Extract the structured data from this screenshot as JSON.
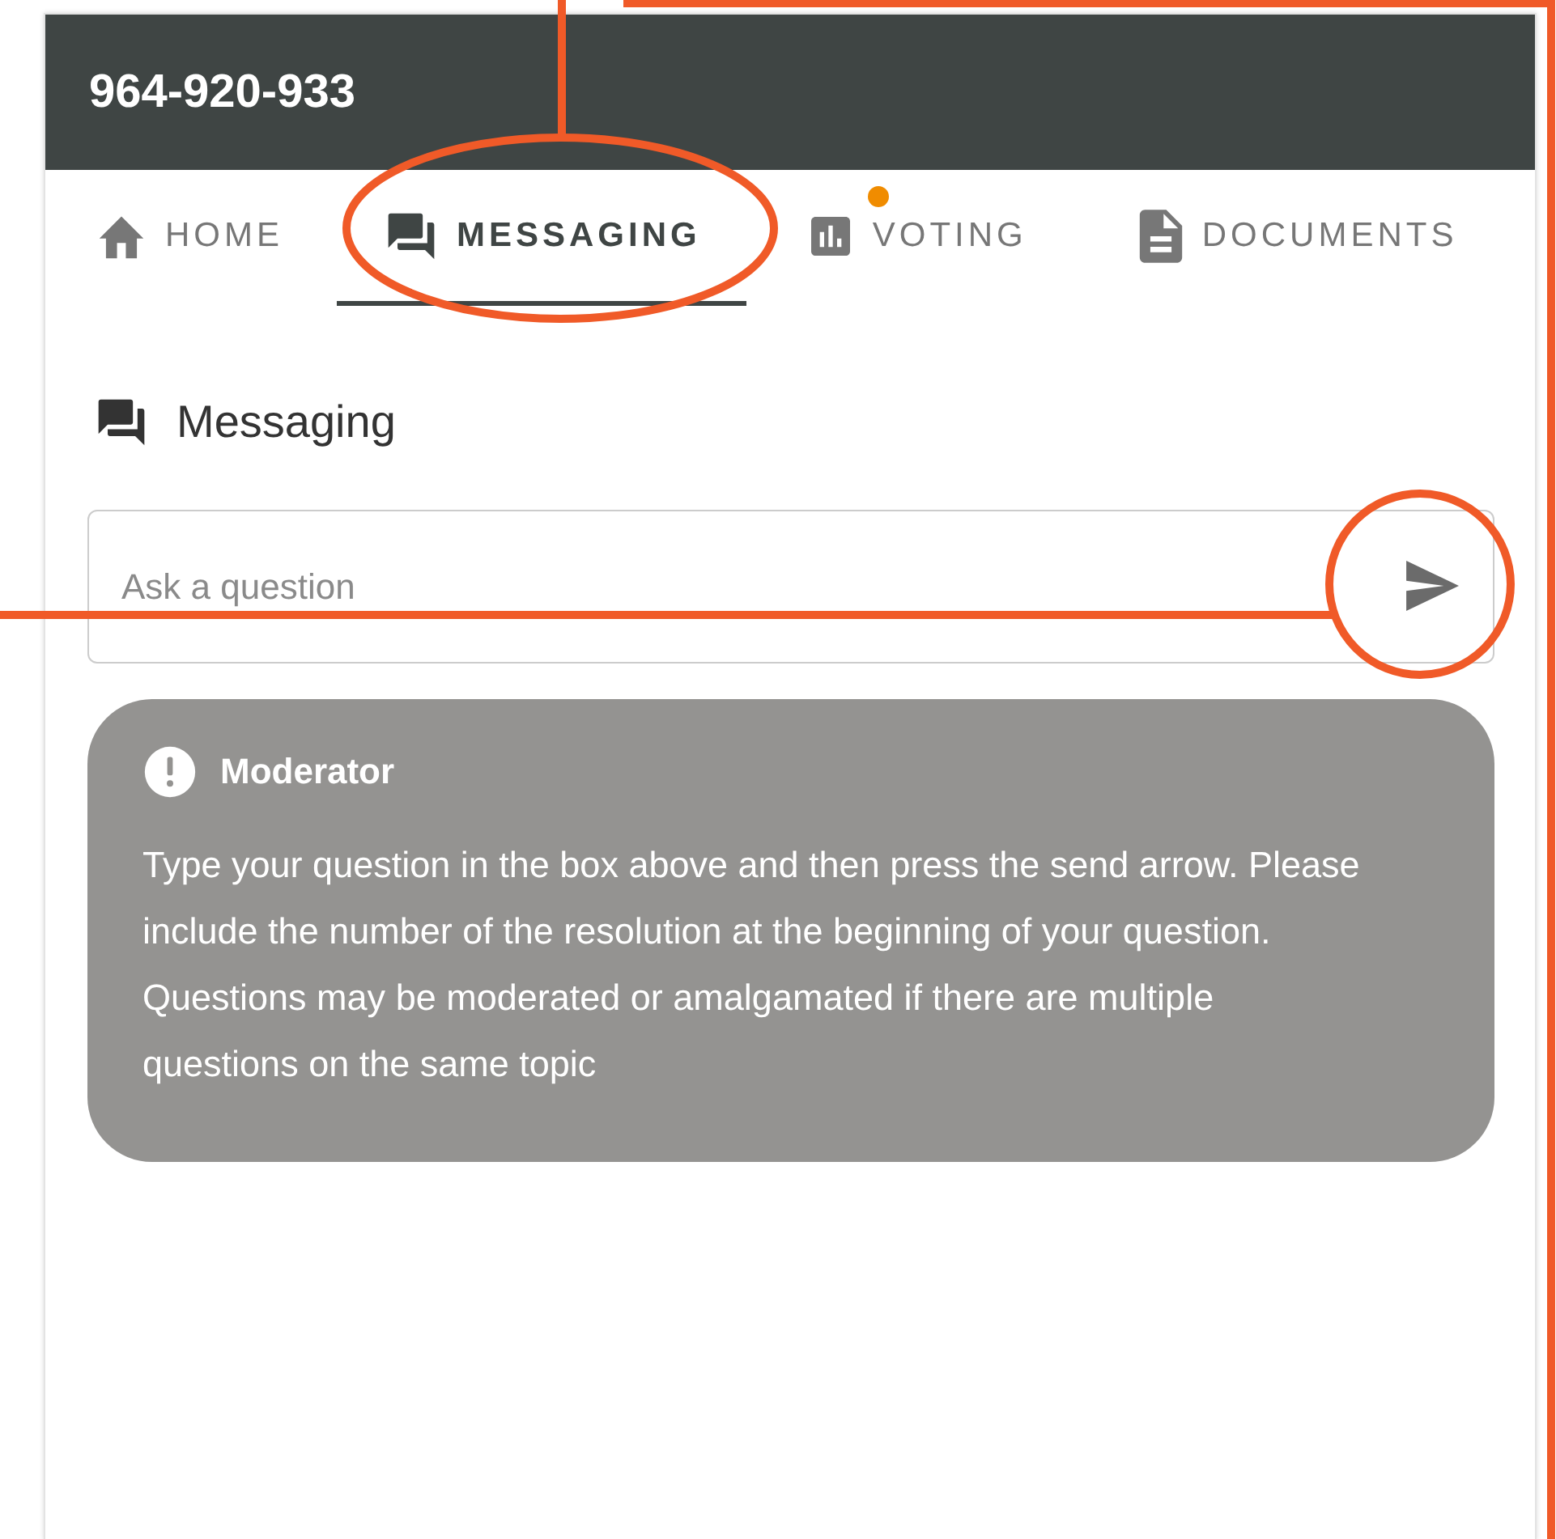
{
  "header": {
    "title": "964-920-933"
  },
  "tabs": [
    {
      "kind": "home",
      "label": "HOME",
      "selected": false,
      "notification": false
    },
    {
      "kind": "messaging",
      "label": "MESSAGING",
      "selected": true,
      "notification": false
    },
    {
      "kind": "voting",
      "label": "VOTING",
      "selected": false,
      "notification": true
    },
    {
      "kind": "documents",
      "label": "DOCUMENTS",
      "selected": false,
      "notification": false
    }
  ],
  "section": {
    "title": "Messaging"
  },
  "question_field": {
    "placeholder": "Ask a question"
  },
  "message": {
    "sender": "Moderator",
    "text": "Type your question in the box above and then press the send arrow. Please include the number of the resolution at the beginning of your question. Questions may be moderated or amalgamated if there are multiple questions on the same topic"
  }
}
